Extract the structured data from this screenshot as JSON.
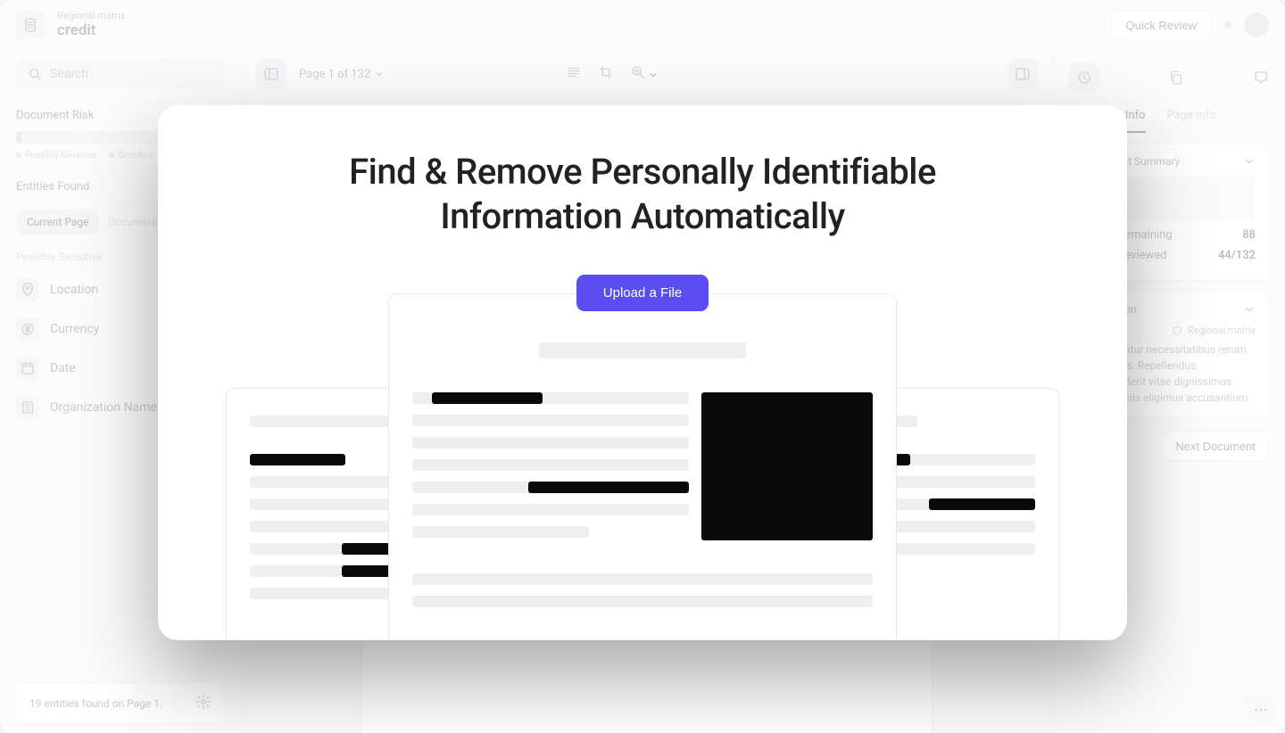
{
  "header": {
    "subtitle": "Regional matrix",
    "title": "credit",
    "quick_review": "Quick Review"
  },
  "sidebar": {
    "search_placeholder": "Search",
    "risk_label": "Document Risk",
    "legend_possibly": "Possibly Sensitive",
    "legend_sensitive": "Sensitive",
    "entities_label": "Entities Found",
    "tab_current": "Current Page",
    "tab_document": "Document",
    "group_label": "Possibly Sensitive",
    "entities": [
      {
        "name": "Location"
      },
      {
        "name": "Currency"
      },
      {
        "name": "Date"
      },
      {
        "name": "Organization Name"
      }
    ],
    "footer_text": "19 entities found on Page 1."
  },
  "center": {
    "page_indicator": "Page 1 of 132"
  },
  "right": {
    "tab_doc": "Document Info",
    "tab_page": "Page Info",
    "summary_label": "Document Summary",
    "pages_remaining_label": "Pages Remaining",
    "pages_remaining_value": "88",
    "pages_reviewed_label": "Pages Reviewed",
    "pages_reviewed_value": "44/132",
    "description_label": "Description",
    "matrix_label": "Regional matrix",
    "description_text": "Consequatur necessitatibus rerum voluptates. Repellendus reprehenderit vitae dignissimos. Fugit officiis eligimus accusantium.",
    "next_doc": "Next Document"
  },
  "modal": {
    "title_line1": "Find & Remove Personally Identifiable",
    "title_line2": "Information Automatically",
    "upload": "Upload a File"
  }
}
